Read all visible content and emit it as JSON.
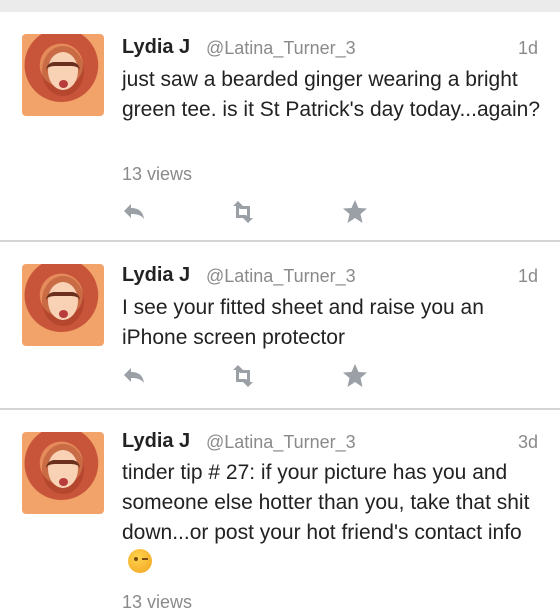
{
  "tweets": [
    {
      "name": "Lydia J",
      "handle": "@Latina_Turner_3",
      "time": "1d",
      "text": "just saw a bearded ginger wearing a bright green tee. is it St Patrick's day today...again?",
      "views": "13 views"
    },
    {
      "name": "Lydia J",
      "handle": "@Latina_Turner_3",
      "time": "1d",
      "text": "I see your fitted sheet and raise you an iPhone screen protector",
      "views": ""
    },
    {
      "name": "Lydia J",
      "handle": "@Latina_Turner_3",
      "time": "3d",
      "text": "tinder tip # 27:  if your picture has you and someone else hotter than you, take that shit down...or post your hot friend's contact info",
      "views": "13 views"
    }
  ],
  "icons": [
    "reply-icon",
    "retweet-icon",
    "favorite-icon",
    "winking-face-emoji"
  ],
  "colors": {
    "secondary_text": "#8a8a8a",
    "divider": "#d4d4d4",
    "icon": "#9aa0a6"
  }
}
